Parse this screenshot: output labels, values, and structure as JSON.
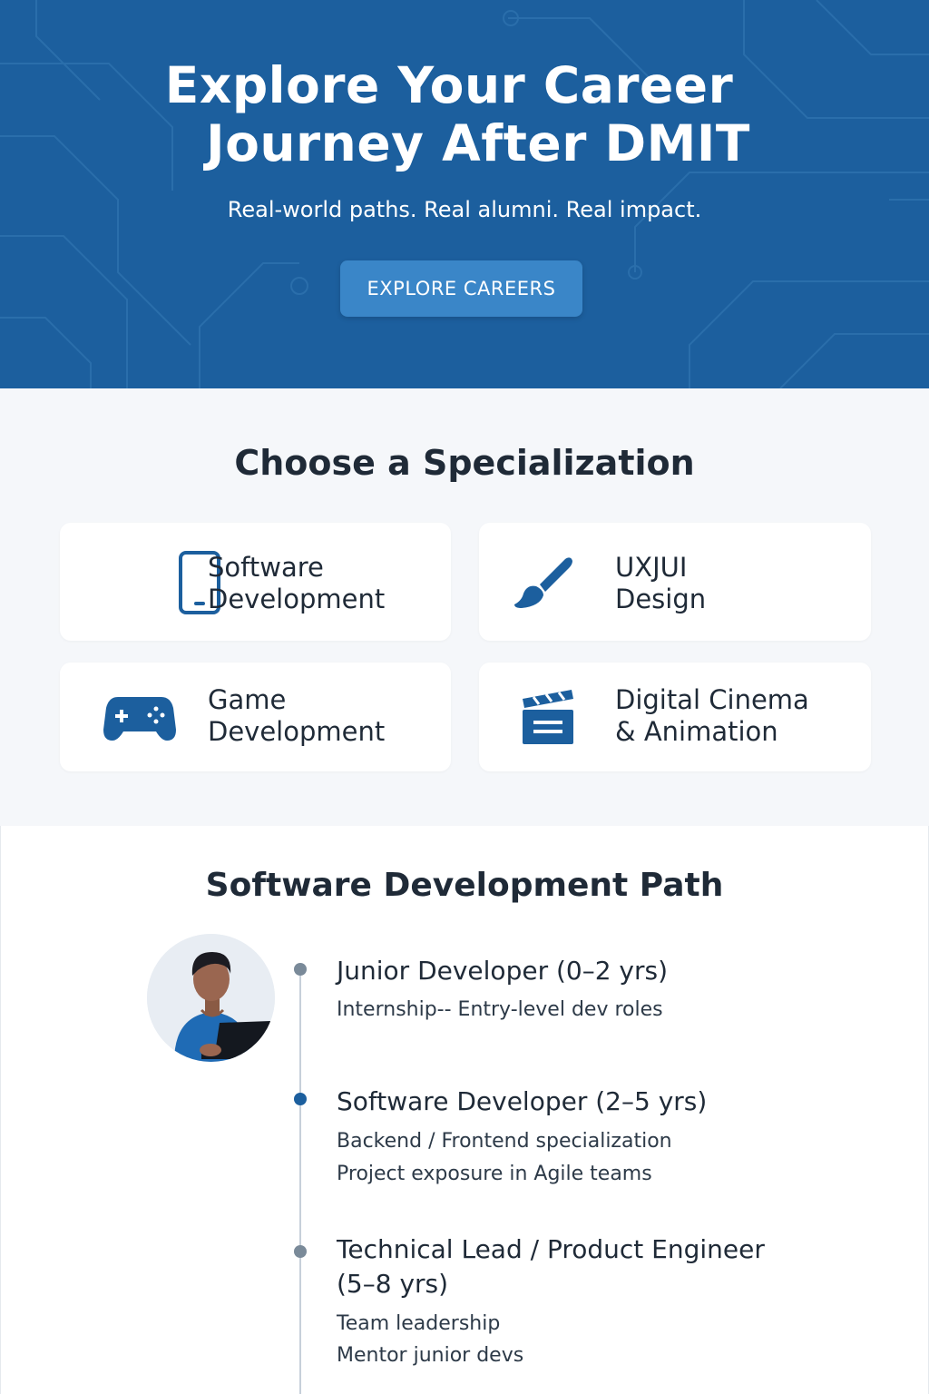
{
  "hero": {
    "title_line1": "Explore Your Career",
    "title_line2": "Journey After DMIT",
    "subtitle": "Real-world paths. Real alumni. Real impact.",
    "button_label": "EXPLORE CAREERS"
  },
  "specialization": {
    "title": "Choose a Specialization",
    "cards": [
      {
        "label": "Software\nDevelopment",
        "icon": "smartphone-icon"
      },
      {
        "label": "UXJUI\nDesign",
        "icon": "paintbrush-icon"
      },
      {
        "label": "Game\nDevelopment",
        "icon": "gamepad-icon"
      },
      {
        "label": "Digital Cinema\n& Animation",
        "icon": "clapperboard-icon"
      }
    ]
  },
  "path": {
    "title": "Software Development Path",
    "avatar_icon": "developer-avatar",
    "steps": [
      {
        "title": "Junior Developer (0–2 yrs)",
        "details": [
          "Internship-- Entry-level dev roles"
        ]
      },
      {
        "title": "Software Developer (2–5 yrs)",
        "details": [
          "Backend / Frontend specialization",
          "Project exposure in Agile teams"
        ]
      },
      {
        "title_line1": "Technical Lead / Product Engineer",
        "title_line2": "(5–8 yrs)",
        "details": [
          "Team leadership",
          "Mentor junior devs"
        ]
      }
    ]
  },
  "colors": {
    "hero_bg": "#1c5f9e",
    "button_bg": "#3a86c8",
    "icon_blue": "#1c5f9e",
    "section_bg": "#f5f7fa",
    "text_dark": "#1f2a37"
  }
}
